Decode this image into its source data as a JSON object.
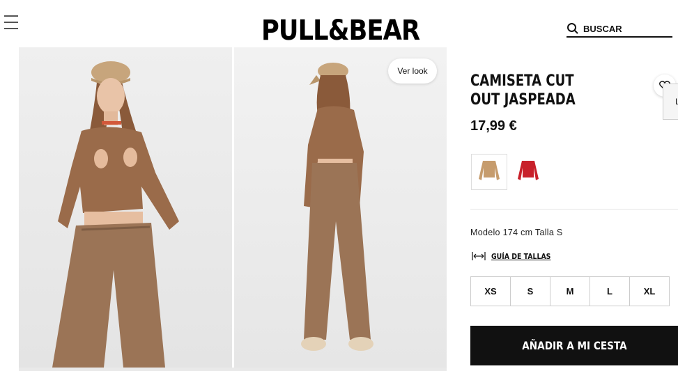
{
  "header": {
    "brand": "PULL&BEAR",
    "search_placeholder": "BUSCAR",
    "icons": [
      "menu-icon",
      "search-icon"
    ]
  },
  "gallery": {
    "ver_look_label": "Ver look",
    "images": [
      "front-view-photo",
      "back-view-photo"
    ]
  },
  "product": {
    "title": "CAMISETA CUT OUT JASPEADA",
    "price": "17,99 €",
    "side_tab_letter": "L",
    "colors": [
      "#c69c6d",
      "#c8202a"
    ],
    "model_info": "Modelo 174 cm Talla S",
    "size_guide_label": "GUÍA DE TALLAS",
    "sizes": [
      "XS",
      "S",
      "M",
      "L",
      "XL"
    ],
    "add_to_cart_label": "AÑADIR A MI CESTA"
  }
}
